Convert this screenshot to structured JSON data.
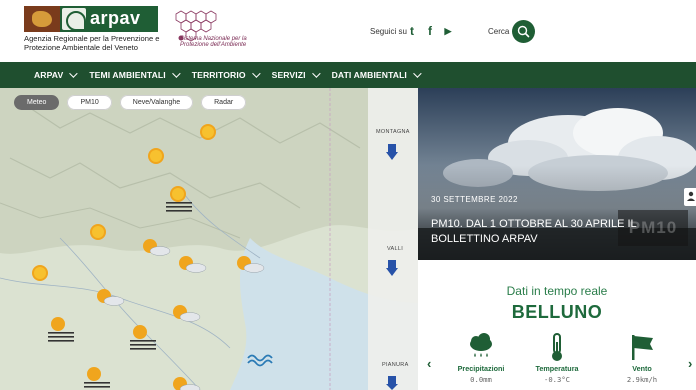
{
  "header": {
    "logo_text": "arpav",
    "agency_name": "Agenzia Regionale per la Prevenzione e Protezione Ambientale del Veneto",
    "snpa_text": "Sistema Nazionale per la Protezione dell'Ambiente",
    "follow_label": "Seguici su",
    "social": [
      {
        "name": "twitter-icon",
        "glyph": "t"
      },
      {
        "name": "facebook-icon",
        "glyph": "f"
      },
      {
        "name": "youtube-icon",
        "glyph": "▶"
      }
    ],
    "search_label": "Cerca"
  },
  "nav": {
    "items": [
      {
        "label": "ARPAV"
      },
      {
        "label": "TEMI AMBIENTALI"
      },
      {
        "label": "TERRITORIO"
      },
      {
        "label": "SERVIZI"
      },
      {
        "label": "DATI AMBIENTALI"
      }
    ]
  },
  "map": {
    "tabs": [
      {
        "label": "Meteo",
        "active": true
      },
      {
        "label": "PM10",
        "active": false
      },
      {
        "label": "Neve/Valanghe",
        "active": false
      },
      {
        "label": "Radar",
        "active": false
      }
    ],
    "labels": [
      "MONTAGNA",
      "VALLI",
      "PIANURA"
    ]
  },
  "hero": {
    "date": "30 SETTEMBRE 2022",
    "title": "PM10. DAL 1 OTTOBRE AL 30 APRILE IL BOLLETTINO ARPAV",
    "watermark": "PM10"
  },
  "realtime": {
    "title": "Dati in tempo reale",
    "city": "BELLUNO",
    "metrics": [
      {
        "label": "Precipitazioni",
        "value": "0.0mm"
      },
      {
        "label": "Temperatura",
        "value": "-0.3°C"
      },
      {
        "label": "Vento",
        "value": "2.9km/h"
      }
    ]
  },
  "colors": {
    "brand_green": "#1f5e35",
    "nav_green": "#1f4f2f",
    "sea": "#cfe1ea"
  }
}
